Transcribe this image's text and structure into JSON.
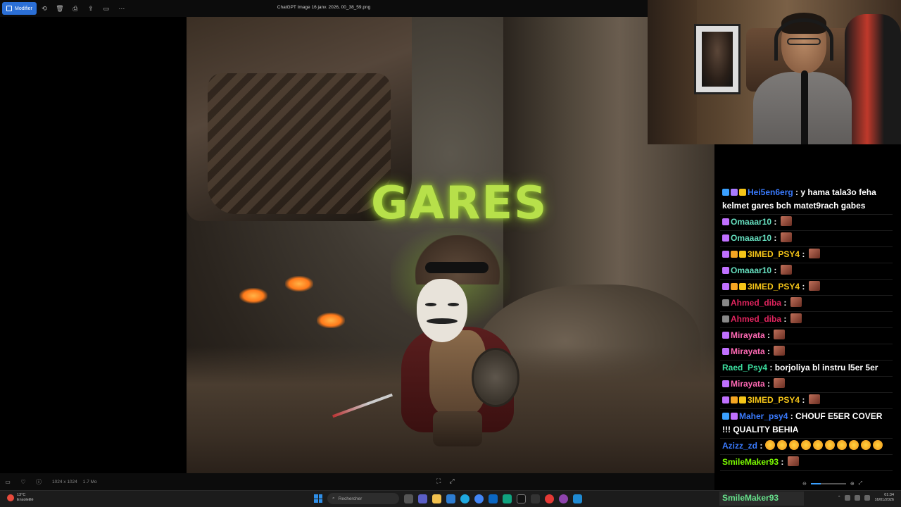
{
  "viewer": {
    "edit_label": "Modifier",
    "file_title": "ChatGPT Image 16 janv. 2026, 00_38_59.png",
    "artwork_text": "GARES",
    "dimensions": "1024 x 1024",
    "file_size": "1.7 Mo"
  },
  "chat": {
    "messages": [
      {
        "user": "Hei5en6erg",
        "color": "#3a7bff",
        "text": " : y hama tala3o feha kelmet gares bch matet9rach gabes",
        "badges": [
          "#3aa0ff",
          "#a97cff",
          "#f5c518"
        ],
        "emote": false
      },
      {
        "user": "Omaaar10",
        "color": "#66e0c0",
        "text": " : ",
        "badges": [
          "#c070ff"
        ],
        "emote": true
      },
      {
        "user": "Omaaar10",
        "color": "#66e0c0",
        "text": " : ",
        "badges": [
          "#c070ff"
        ],
        "emote": true
      },
      {
        "user": "3IMED_PSY4",
        "color": "#f5c518",
        "text": " : ",
        "badges": [
          "#c070ff",
          "#f5a623",
          "#f5c518"
        ],
        "emote": true
      },
      {
        "user": "Omaaar10",
        "color": "#66e0c0",
        "text": " : ",
        "badges": [
          "#c070ff"
        ],
        "emote": true
      },
      {
        "user": "3IMED_PSY4",
        "color": "#f5c518",
        "text": " : ",
        "badges": [
          "#c070ff",
          "#f5a623",
          "#f5c518"
        ],
        "emote": true
      },
      {
        "user": "Ahmed_diba",
        "color": "#e0245e",
        "text": " : ",
        "badges": [
          "#888888"
        ],
        "emote": true
      },
      {
        "user": "Ahmed_diba",
        "color": "#e0245e",
        "text": " : ",
        "badges": [
          "#888888"
        ],
        "emote": true
      },
      {
        "user": "Mirayata",
        "color": "#ff69b4",
        "text": " : ",
        "badges": [
          "#c070ff"
        ],
        "emote": true
      },
      {
        "user": "Mirayata",
        "color": "#ff69b4",
        "text": " : ",
        "badges": [
          "#c070ff"
        ],
        "emote": true
      },
      {
        "user": "Raed_Psy4",
        "color": "#3ce0a0",
        "text": " : borjoliya bl instru l5er 5er",
        "badges": [],
        "emote": false
      },
      {
        "user": "Mirayata",
        "color": "#ff69b4",
        "text": " : ",
        "badges": [
          "#c070ff"
        ],
        "emote": true
      },
      {
        "user": "3IMED_PSY4",
        "color": "#f5c518",
        "text": " : ",
        "badges": [
          "#c070ff",
          "#f5a623",
          "#f5c518"
        ],
        "emote": true
      },
      {
        "user": "Maher_psy4",
        "color": "#3a7bff",
        "text": " : CHOUF E5ER COVER !!! QUALITY BEHIA",
        "badges": [
          "#3aa0ff",
          "#c070ff"
        ],
        "emote": false
      },
      {
        "user": "Azizz_zd",
        "color": "#3a7bff",
        "text": " : ",
        "badges": [],
        "emote": false,
        "emojis": 10
      },
      {
        "user": "SmileMaker93",
        "color": "#7cfc00",
        "text": " : ",
        "badges": [],
        "emote": true
      }
    ],
    "overlay_user": "SmileMaker93"
  },
  "taskbar": {
    "weather_temp": "13°C",
    "weather_desc": "Ensoleillé",
    "search_placeholder": "Rechercher",
    "time": "01:34",
    "date": "16/01/2026"
  }
}
